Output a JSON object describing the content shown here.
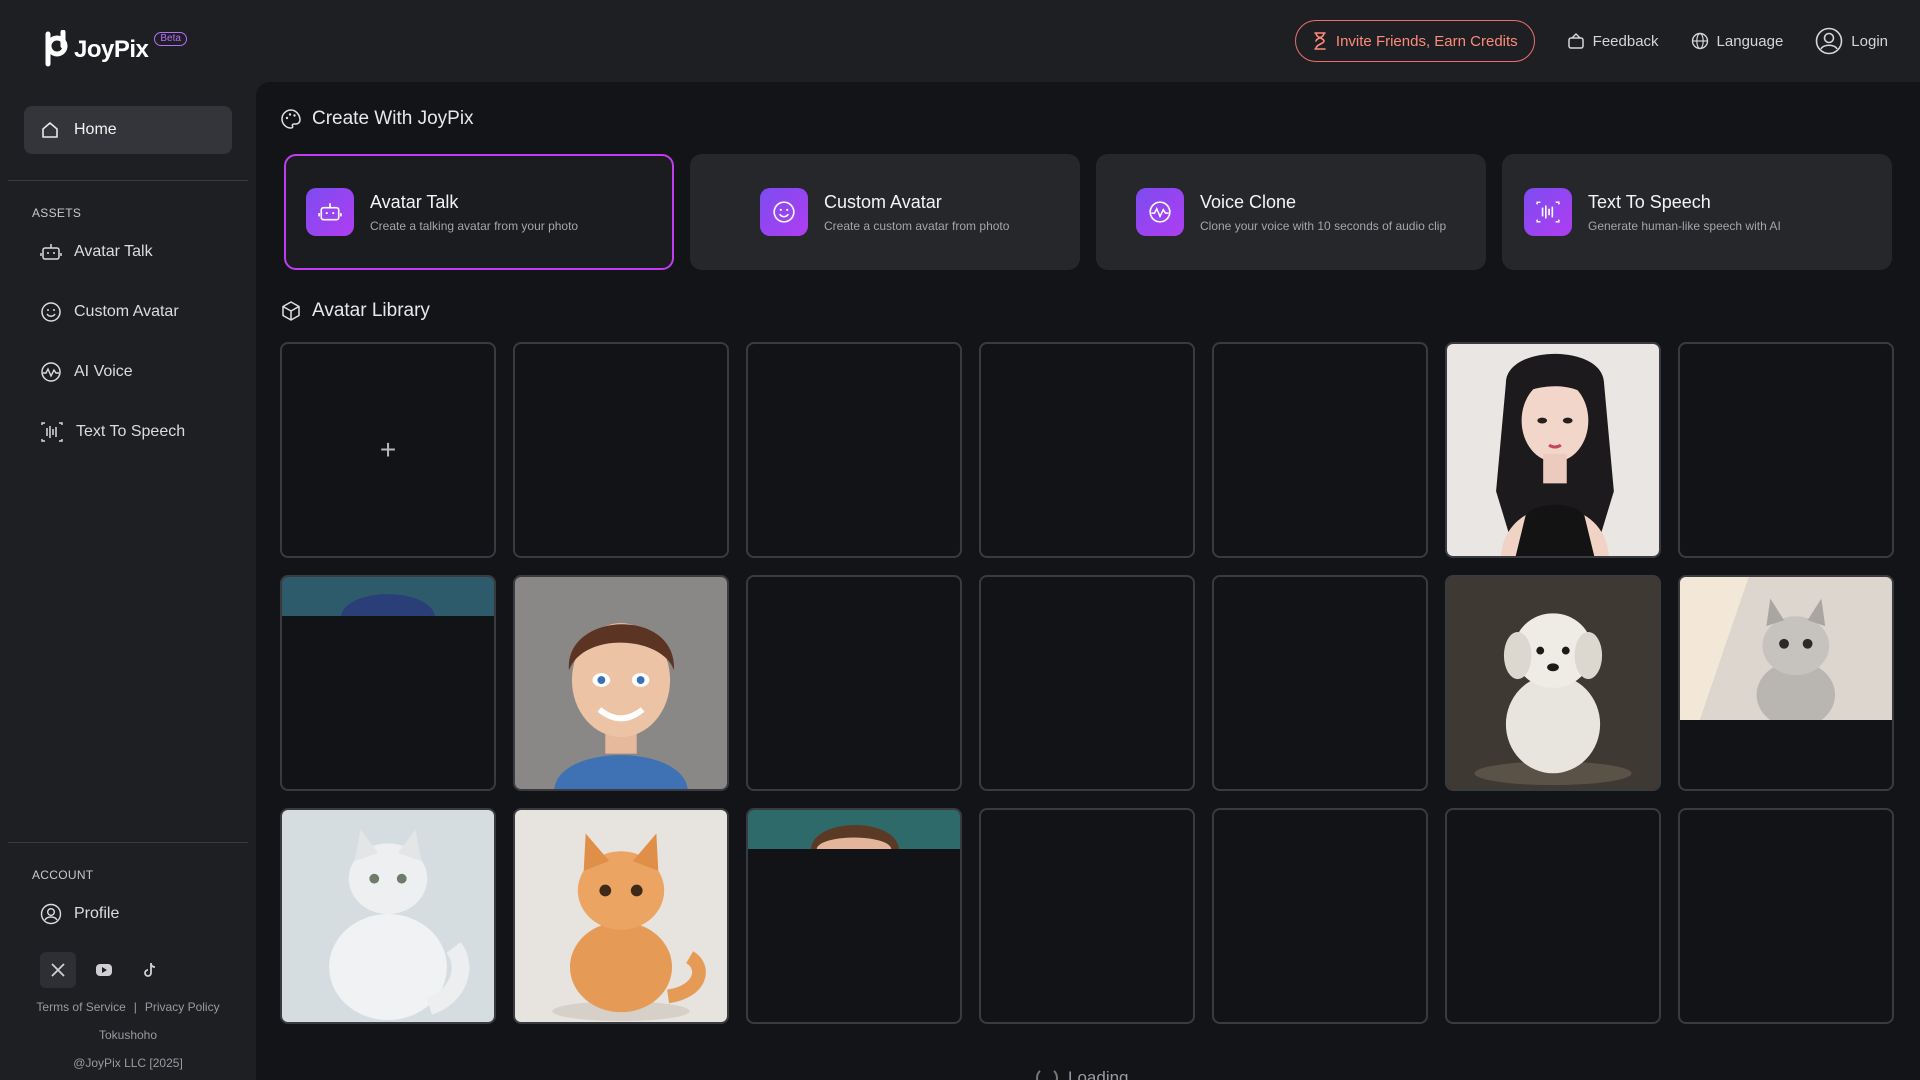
{
  "brand": {
    "name": "JoyPix",
    "badge": "Beta"
  },
  "header": {
    "invite_label": "Invite Friends, Earn Credits",
    "feedback_label": "Feedback",
    "language_label": "Language",
    "login_label": "Login"
  },
  "sidebar": {
    "home_label": "Home",
    "assets_title": "ASSETS",
    "assets": [
      {
        "label": "Avatar Talk",
        "icon": "robot-icon"
      },
      {
        "label": "Custom Avatar",
        "icon": "smile-icon"
      },
      {
        "label": "AI Voice",
        "icon": "voice-wave-icon"
      },
      {
        "label": "Text To Speech",
        "icon": "speech-bars-icon"
      }
    ],
    "account_title": "ACCOUNT",
    "profile_label": "Profile",
    "socials": [
      "x-icon",
      "youtube-icon",
      "tiktok-icon"
    ],
    "legal": {
      "terms": "Terms of Service",
      "separator": "|",
      "privacy": "Privacy Policy",
      "tokushoho": "Tokushoho",
      "copyright": "@JoyPix LLC [2025]"
    }
  },
  "main": {
    "create_title": "Create With JoyPix",
    "cards": [
      {
        "title": "Avatar Talk",
        "subtitle": "Create a talking avatar from your photo",
        "icon": "robot-icon",
        "selected": true
      },
      {
        "title": "Custom Avatar",
        "subtitle": "Create a custom avatar from photo",
        "icon": "smile-icon",
        "selected": false
      },
      {
        "title": "Voice Clone",
        "subtitle": "Clone your voice with 10 seconds of audio clip",
        "icon": "voice-wave-icon",
        "selected": false
      },
      {
        "title": "Text To Speech",
        "subtitle": "Generate human-like speech with AI",
        "icon": "speech-bars-icon",
        "selected": false
      }
    ],
    "library_title": "Avatar Library",
    "add_symbol": "+",
    "tiles": [
      "add",
      "empty",
      "empty",
      "empty",
      "empty",
      "woman-portrait",
      "empty",
      "partial-blue-hair",
      "boy-portrait",
      "empty",
      "empty",
      "empty",
      "white-puppy",
      "partial-kitten",
      "white-cat",
      "orange-kitten",
      "partial-brown-hair",
      "empty",
      "empty",
      "empty",
      "empty"
    ],
    "loading_label": "Loading"
  },
  "colors": {
    "accent_border": "#c13df0",
    "card_icon_gradient_start": "#7c4cf0",
    "card_icon_gradient_end": "#b03df2",
    "invite_red": "#f06d6d"
  }
}
